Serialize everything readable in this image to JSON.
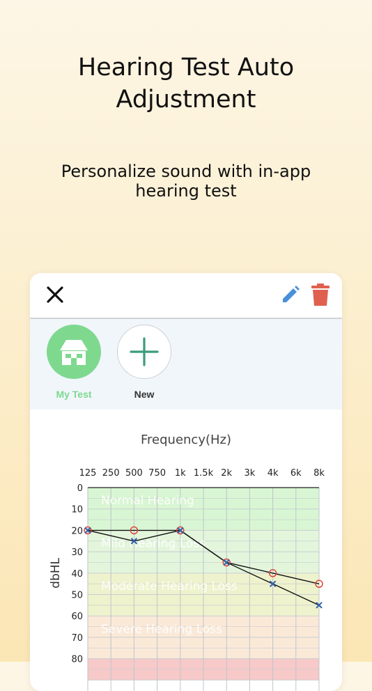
{
  "headline": {
    "line1": "Hearing Test Auto",
    "line2": "Adjustment"
  },
  "subline": {
    "line1": "Personalize sound with in-app",
    "line2": "hearing test"
  },
  "toolbar": {
    "close_icon": "close-icon",
    "edit_icon": "pencil-icon",
    "delete_icon": "trash-icon",
    "colors": {
      "edit": "#4a90d9",
      "delete": "#e0604f"
    }
  },
  "profiles": [
    {
      "label": "My Test",
      "icon": "house-icon",
      "selected": true
    },
    {
      "label": "New",
      "icon": "plus-icon",
      "selected": false
    }
  ],
  "chart_data": {
    "type": "line",
    "title": "Frequency(Hz)",
    "xlabel": "Frequency(Hz)",
    "ylabel": "dbHL",
    "x_ticks": [
      "125",
      "250",
      "500",
      "750",
      "1k",
      "1.5k",
      "2k",
      "3k",
      "4k",
      "6k",
      "8k"
    ],
    "y_ticks": [
      "0",
      "10",
      "20",
      "30",
      "40",
      "50",
      "60",
      "70",
      "80"
    ],
    "ylim": [
      0,
      80
    ],
    "grid": true,
    "bands": [
      {
        "label": "Normal Hearing",
        "from": 0,
        "to": 20,
        "color": "#d8f6d3"
      },
      {
        "label": "Mild Hearing Loss",
        "from": 20,
        "to": 40,
        "color": "#e3f6dc"
      },
      {
        "label": "Moderate Hearing Loss",
        "from": 40,
        "to": 60,
        "color": "#eef3cd"
      },
      {
        "label": "Severe Hearing Loss",
        "from": 60,
        "to": 80,
        "color": "#fbe9d8"
      },
      {
        "label": "",
        "from": 80,
        "to": 90,
        "color": "#f7c9c9"
      }
    ],
    "series": [
      {
        "marker": "circle",
        "color": "#e0453a",
        "points": [
          {
            "x": "125",
            "y": 20
          },
          {
            "x": "500",
            "y": 20
          },
          {
            "x": "1k",
            "y": 20
          },
          {
            "x": "2k",
            "y": 35
          },
          {
            "x": "4k",
            "y": 40
          },
          {
            "x": "8k",
            "y": 45
          }
        ]
      },
      {
        "marker": "cross",
        "color": "#2f5fa6",
        "points": [
          {
            "x": "125",
            "y": 20
          },
          {
            "x": "500",
            "y": 25
          },
          {
            "x": "1k",
            "y": 20
          },
          {
            "x": "2k",
            "y": 35
          },
          {
            "x": "4k",
            "y": 45
          },
          {
            "x": "8k",
            "y": 55
          }
        ]
      }
    ]
  }
}
